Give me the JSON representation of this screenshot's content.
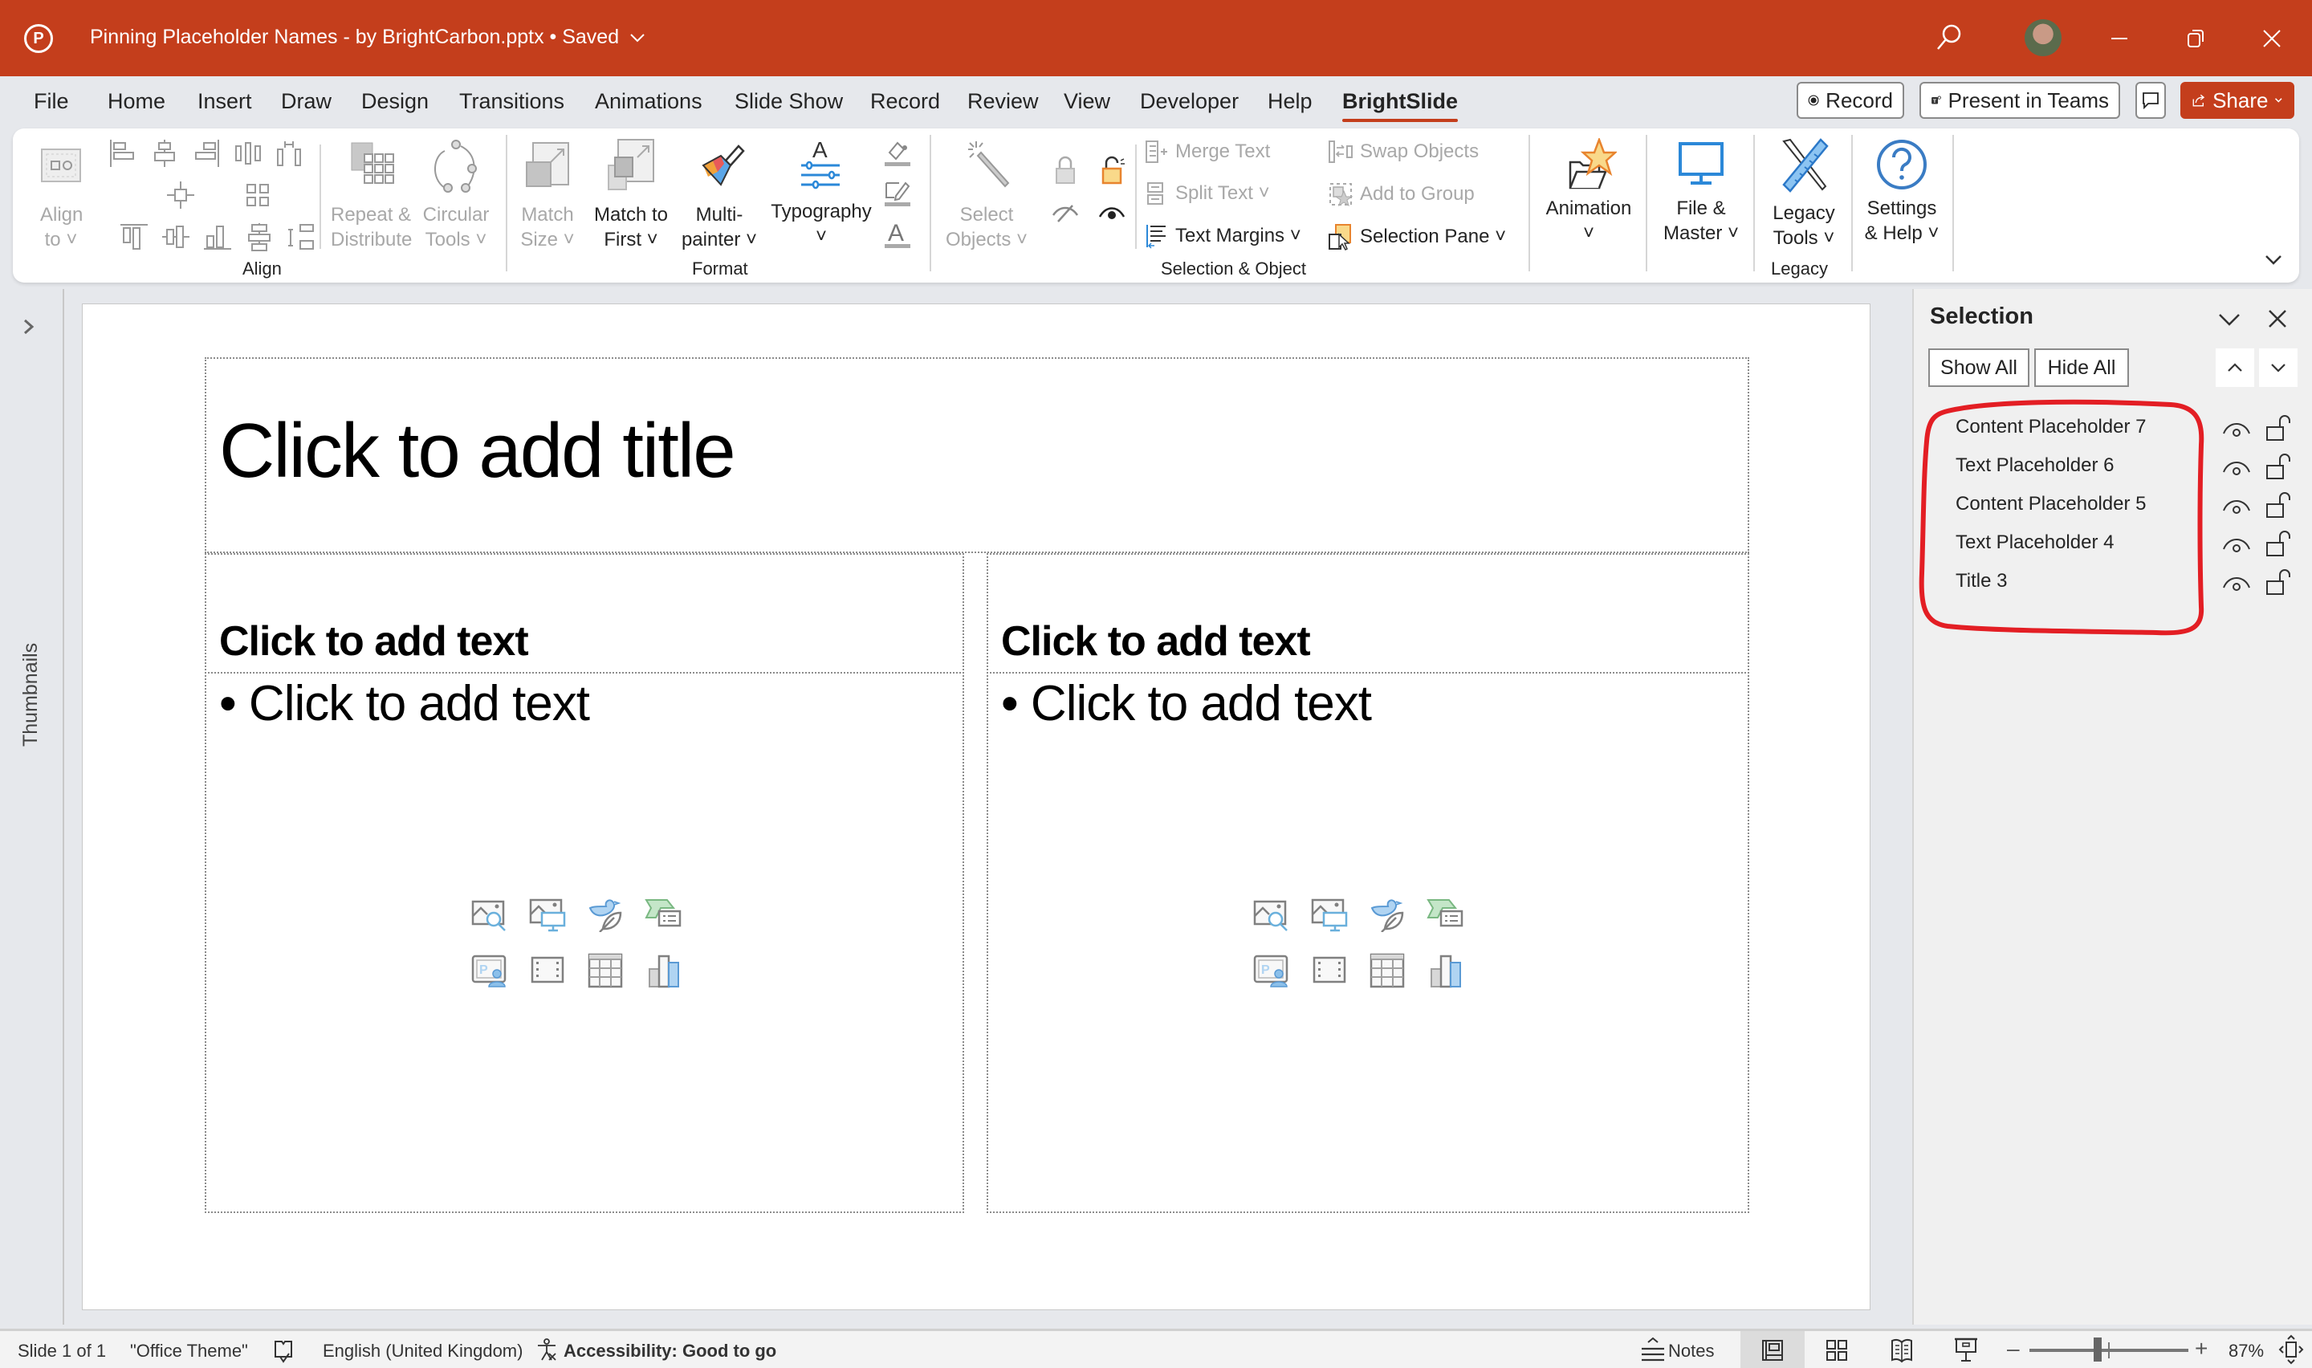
{
  "titlebar": {
    "app_icon": "powerpoint-icon",
    "document_title": "Pinning Placeholder Names  - by BrightCarbon.pptx",
    "save_status": "• Saved",
    "title_menu_chevron": "chevron-down-icon",
    "icons": [
      "search-icon",
      "avatar",
      "minimize-icon",
      "restore-icon",
      "close-icon"
    ]
  },
  "menu_tabs": [
    {
      "label": "File"
    },
    {
      "label": "Home"
    },
    {
      "label": "Insert"
    },
    {
      "label": "Draw"
    },
    {
      "label": "Design"
    },
    {
      "label": "Transitions"
    },
    {
      "label": "Animations"
    },
    {
      "label": "Slide Show"
    },
    {
      "label": "Record"
    },
    {
      "label": "Review"
    },
    {
      "label": "View"
    },
    {
      "label": "Developer"
    },
    {
      "label": "Help"
    },
    {
      "label": "BrightSlide",
      "active": true
    }
  ],
  "top_actions": {
    "record": "Record",
    "present_in_teams": "Present in Teams",
    "comments_icon": "comment-icon",
    "share": "Share"
  },
  "ribbon": {
    "align_group": {
      "label": "Align",
      "align_to": [
        "Align",
        "to ˅"
      ],
      "repeat_distribute": [
        "Repeat &",
        "Distribute"
      ],
      "circular_tools": [
        "Circular",
        "Tools ˅"
      ]
    },
    "format_group": {
      "label": "Format",
      "match_size": [
        "Match",
        "Size ˅"
      ],
      "match_to_first": [
        "Match to",
        "First ˅"
      ],
      "multi_painter": [
        "Multi-",
        "painter ˅"
      ],
      "typography": [
        "Typography",
        "˅"
      ]
    },
    "selection_group": {
      "label": "Selection & Object",
      "select_objects": [
        "Select",
        "Objects ˅"
      ],
      "merge_text": "Merge Text",
      "split_text": "Split Text ˅",
      "text_margins": "Text Margins ˅",
      "swap_objects": "Swap Objects",
      "add_to_group": "Add to Group",
      "selection_pane": "Selection Pane ˅"
    },
    "animation": [
      "Animation",
      "˅"
    ],
    "file_master": [
      "File &",
      "Master ˅"
    ],
    "legacy_group": {
      "label": "Legacy",
      "legacy_tools": [
        "Legacy",
        "Tools ˅"
      ]
    },
    "settings_help": [
      "Settings",
      "& Help ˅"
    ],
    "collapse_icon": "chevron-down-icon"
  },
  "thumbnails": {
    "label": "Thumbnails",
    "expand_icon": "chevron-right-icon"
  },
  "slide": {
    "title_placeholder": "Click to add title",
    "left_heading": "Click to add text",
    "left_body": "• Click to add text",
    "right_heading": "Click to add text",
    "right_body": "• Click to add text",
    "insert_icons": [
      "insert-stock-image-icon",
      "insert-online-picture-icon",
      "insert-icons-icon",
      "insert-smartart-icon",
      "insert-cameo-icon",
      "insert-video-icon",
      "insert-table-icon",
      "insert-chart-icon"
    ]
  },
  "selection_pane": {
    "title": "Selection",
    "show_all": "Show All",
    "hide_all": "Hide All",
    "items": [
      {
        "name": "Content Placeholder 7",
        "visible": true,
        "locked": false
      },
      {
        "name": "Text Placeholder 6",
        "visible": true,
        "locked": false
      },
      {
        "name": "Content Placeholder 5",
        "visible": true,
        "locked": false
      },
      {
        "name": "Text Placeholder 4",
        "visible": true,
        "locked": false
      },
      {
        "name": "Title 3",
        "visible": true,
        "locked": false
      }
    ],
    "annotation_color": "#e31e24"
  },
  "statusbar": {
    "slide_info": "Slide 1 of 1",
    "theme": "\"Office Theme\"",
    "language": "English (United Kingdom)",
    "accessibility": "Accessibility: Good to go",
    "notes": "Notes",
    "zoom_percent": "87%",
    "zoom_value": 87
  },
  "colors": {
    "brand": "#c43e1c",
    "accent_blue": "#2b88d8"
  }
}
